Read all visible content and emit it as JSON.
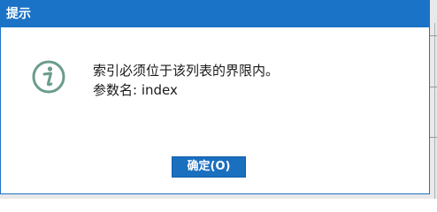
{
  "dialog": {
    "title": "提示",
    "icon": "info-icon",
    "message_line1": "索引必须位于该列表的界限内。",
    "message_line2": "参数名: index",
    "ok_label": "确定(O)"
  },
  "colors": {
    "titlebar": "#1a73c6",
    "button": "#1a6fbf",
    "icon": "#6a9c8c"
  }
}
